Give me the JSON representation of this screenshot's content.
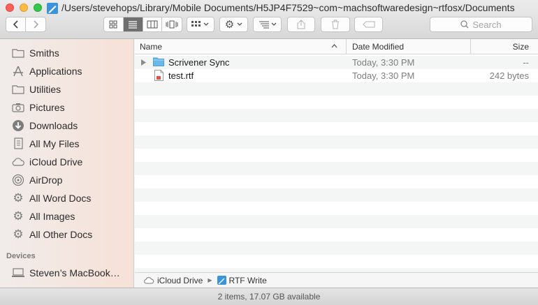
{
  "window": {
    "title": "/Users/stevehops/Library/Mobile Documents/H5JP4F7529~com~machsoftwaredesign~rtfosx/Documents"
  },
  "toolbar": {
    "search_placeholder": "Search"
  },
  "sidebar": {
    "items": [
      {
        "label": "Smiths",
        "icon": "folder-icon"
      },
      {
        "label": "Applications",
        "icon": "applications-icon"
      },
      {
        "label": "Utilities",
        "icon": "folder-icon"
      },
      {
        "label": "Pictures",
        "icon": "camera-icon"
      },
      {
        "label": "Downloads",
        "icon": "download-icon"
      },
      {
        "label": "All My Files",
        "icon": "files-icon"
      },
      {
        "label": "iCloud Drive",
        "icon": "cloud-icon"
      },
      {
        "label": "AirDrop",
        "icon": "airdrop-icon"
      },
      {
        "label": "All Word Docs",
        "icon": "gear-icon"
      },
      {
        "label": "All Images",
        "icon": "gear-icon"
      },
      {
        "label": "All Other Docs",
        "icon": "gear-icon"
      }
    ],
    "devices_heading": "Devices",
    "devices": [
      {
        "label": "Steven’s MacBook…",
        "icon": "laptop-icon"
      }
    ]
  },
  "columns": {
    "name": "Name",
    "date_modified": "Date Modified",
    "size": "Size"
  },
  "files": [
    {
      "name": "Scrivener Sync",
      "date": "Today, 3:30 PM",
      "size": "--",
      "kind": "folder"
    },
    {
      "name": "test.rtf",
      "date": "Today, 3:30 PM",
      "size": "242 bytes",
      "kind": "document"
    }
  ],
  "pathbar": {
    "root": "iCloud Drive",
    "current": "RTF Write"
  },
  "status": "2 items, 17.07 GB available",
  "colors": {
    "accent": "#3b93dc",
    "folder": "#6bb8ec",
    "close": "#fc605c",
    "minimize": "#fdbc40",
    "maximize": "#34c84a"
  }
}
